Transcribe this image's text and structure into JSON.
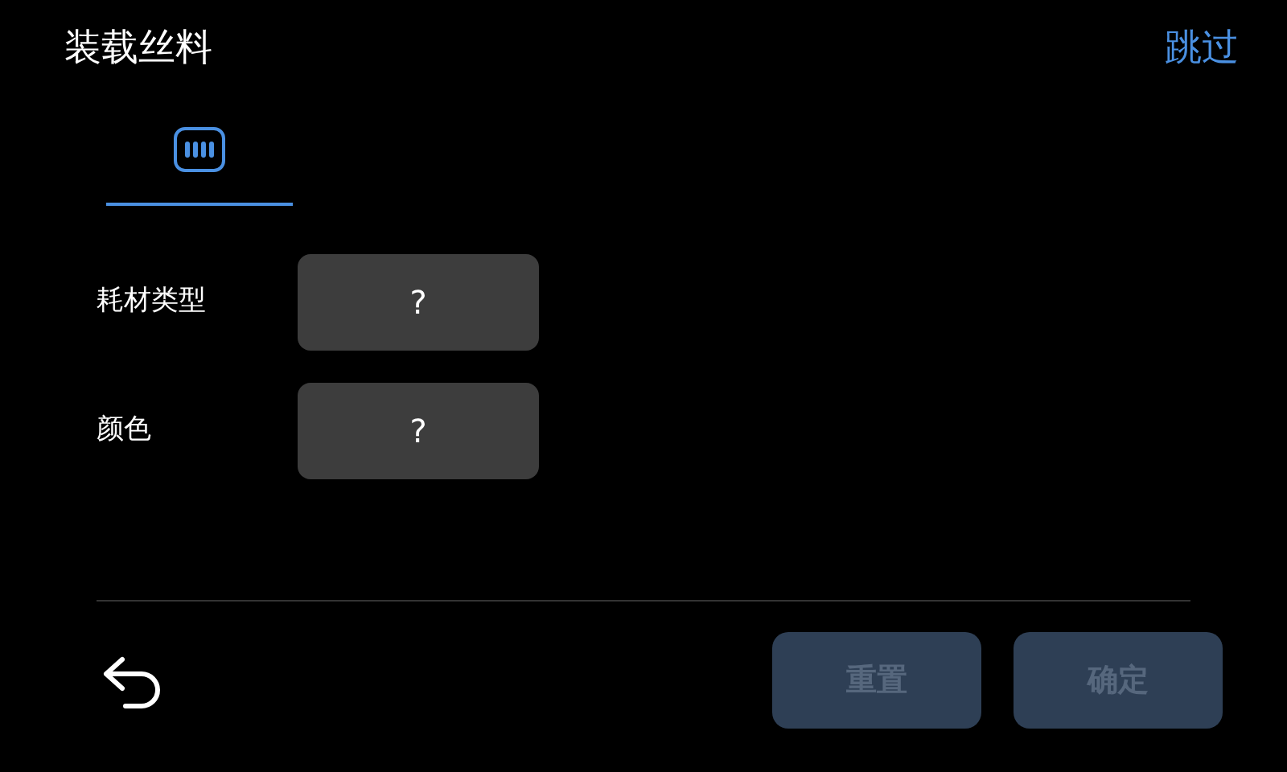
{
  "title": "装载丝料",
  "skip": "跳过",
  "tabs": [
    {
      "selected": true
    }
  ],
  "fields": [
    {
      "label": "耗材类型",
      "value": "?"
    },
    {
      "label": "颜色",
      "value": "?"
    }
  ],
  "buttons": [
    {
      "label": "重置",
      "disabled": true
    },
    {
      "label": "确定",
      "disabled": true
    }
  ]
}
